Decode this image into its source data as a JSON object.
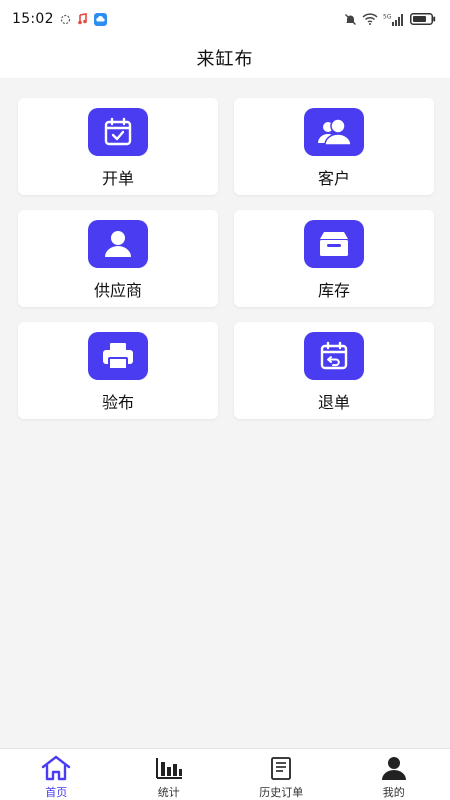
{
  "status_bar": {
    "time": "15:02",
    "network_label": "5G",
    "colors": {
      "music": "#e64a3c",
      "cloud": "#2d8ef0"
    }
  },
  "header": {
    "title": "来缸布"
  },
  "menu": {
    "accent_color": "#4a3cf0",
    "items": [
      {
        "label": "开单",
        "icon": "calendar-check-icon"
      },
      {
        "label": "客户",
        "icon": "users-icon"
      },
      {
        "label": "供应商",
        "icon": "user-icon"
      },
      {
        "label": "库存",
        "icon": "inventory-box-icon"
      },
      {
        "label": "验布",
        "icon": "printer-icon"
      },
      {
        "label": "退单",
        "icon": "calendar-return-icon"
      }
    ]
  },
  "bottom_nav": {
    "active_color": "#4a3cf0",
    "items": [
      {
        "label": "首页",
        "icon": "home-icon",
        "active": true
      },
      {
        "label": "统计",
        "icon": "bar-chart-icon",
        "active": false
      },
      {
        "label": "历史订单",
        "icon": "order-history-icon",
        "active": false
      },
      {
        "label": "我的",
        "icon": "profile-icon",
        "active": false
      }
    ]
  }
}
